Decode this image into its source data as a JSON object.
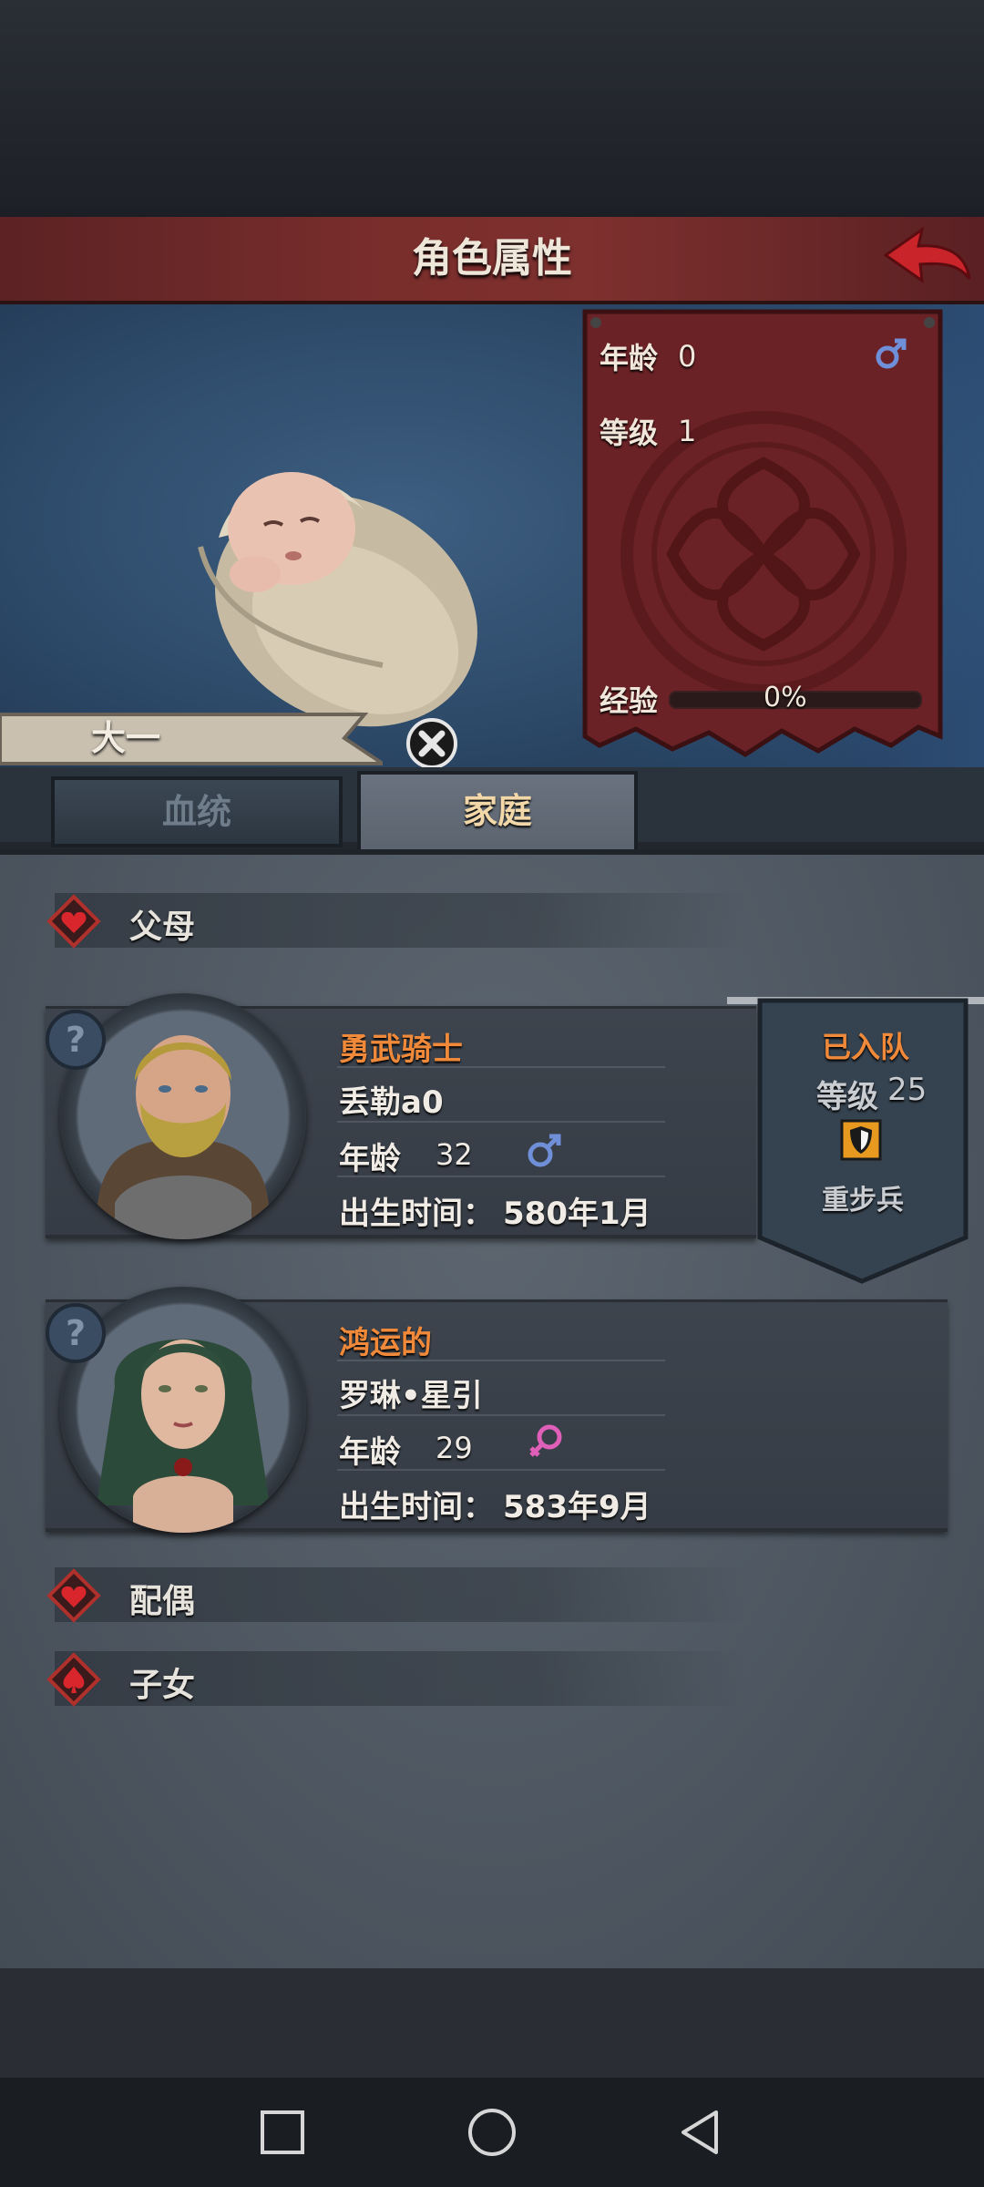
{
  "header": {
    "title": "角色属性"
  },
  "character": {
    "name": "大一",
    "stats": {
      "age_label": "年龄",
      "age_value": "0",
      "level_label": "等级",
      "level_value": "1",
      "exp_label": "经验",
      "exp_value": "0%",
      "exp_progress": 0
    }
  },
  "tabs": [
    {
      "label": "血统",
      "active": false
    },
    {
      "label": "家庭",
      "active": true
    }
  ],
  "sections": {
    "parents": "父母",
    "spouse": "配偶",
    "children": "子女"
  },
  "parents": [
    {
      "trait": "勇武骑士",
      "name": "丢勒a0",
      "age_label": "年龄",
      "age": "32",
      "gender": "male",
      "birth_label": "出生时间：",
      "birth": "580年1月",
      "joined": {
        "status": "已入队",
        "level_label": "等级",
        "level": "25",
        "unit": "重步兵",
        "icon": "shield-icon"
      }
    },
    {
      "trait": "鸿运的",
      "name": "罗琳•星引",
      "age_label": "年龄",
      "age": "29",
      "gender": "female",
      "birth_label": "出生时间：",
      "birth": "583年9月"
    }
  ],
  "colors": {
    "header": "#7a2e2c",
    "trait": "#f08a3a",
    "male": "#6f8fd8",
    "female": "#e05fb8"
  }
}
